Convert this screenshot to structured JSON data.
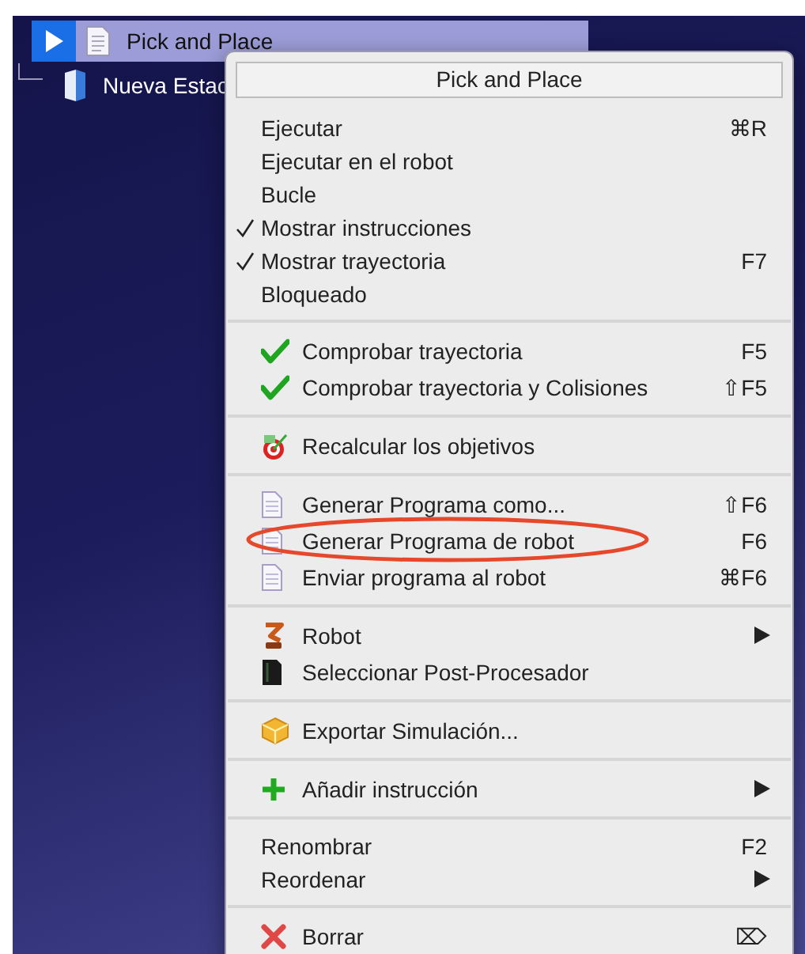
{
  "tree": [
    {
      "label": "Pick and Place",
      "selected": true,
      "expanded": false
    },
    {
      "label": "Nueva Estac",
      "selected": false
    }
  ],
  "context_menu": {
    "title": "Pick and Place",
    "groups": [
      {
        "items": [
          {
            "label": "Ejecutar",
            "shortcut": "⌘R",
            "checked": false
          },
          {
            "label": "Ejecutar en el robot",
            "checked": false
          },
          {
            "label": "Bucle",
            "checked": false
          },
          {
            "label": "Mostrar instrucciones",
            "checked": true
          },
          {
            "label": "Mostrar trayectoria",
            "shortcut": "F7",
            "checked": true
          },
          {
            "label": "Bloqueado",
            "checked": false
          }
        ]
      },
      {
        "items": [
          {
            "label": "Comprobar trayectoria",
            "shortcut": "F5"
          },
          {
            "label": "Comprobar trayectoria y Colisiones",
            "shortcut": "⇧F5"
          }
        ]
      },
      {
        "items": [
          {
            "label": "Recalcular los objetivos"
          }
        ]
      },
      {
        "items": [
          {
            "label": "Generar Programa como...",
            "shortcut": "⇧F6",
            "circled": false
          },
          {
            "label": "Generar Programa de robot",
            "shortcut": "F6",
            "circled": true
          },
          {
            "label": "Enviar programa al robot",
            "shortcut": "⌘F6",
            "circled": false
          }
        ]
      },
      {
        "items": [
          {
            "label": "Robot",
            "submenu": true
          },
          {
            "label": "Seleccionar Post-Procesador",
            "submenu": false
          }
        ]
      },
      {
        "items": [
          {
            "label": "Exportar Simulación..."
          }
        ]
      },
      {
        "items": [
          {
            "label": "Añadir instrucción",
            "submenu": true
          }
        ]
      },
      {
        "items": [
          {
            "label": "Renombrar",
            "shortcut": "F2",
            "submenu": false
          },
          {
            "label": "Reordenar",
            "submenu": true
          }
        ]
      },
      {
        "items": [
          {
            "label": "Borrar",
            "shortcut": "⌦"
          }
        ]
      }
    ]
  }
}
